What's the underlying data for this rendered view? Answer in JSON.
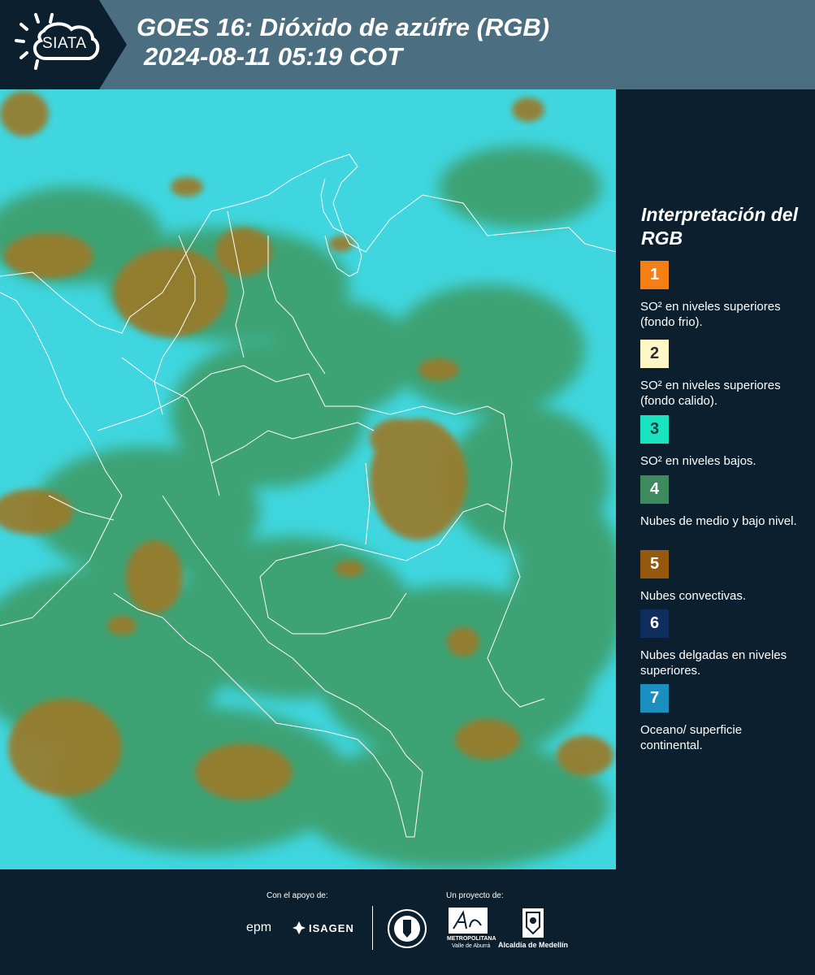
{
  "header": {
    "title_line1": "GOES 16: Dióxido de azúfre (RGB)",
    "title_line2": "2024-08-11 05:19 COT",
    "logo_text": "SIATA"
  },
  "legend": {
    "title": "Interpretación del RGB",
    "items": [
      {
        "number": "1",
        "label": "SO² en niveles superiores (fondo frio).",
        "color": "#f57f17",
        "text_color": "#ffffff"
      },
      {
        "number": "2",
        "label": "SO² en niveles superiores (fondo calido).",
        "color": "#fff8c6",
        "text_color": "#2a2a2a"
      },
      {
        "number": "3",
        "label": "SO² en niveles bajos.",
        "color": "#19e3c0",
        "text_color": "#1f3a3a"
      },
      {
        "number": "4",
        "label": "Nubes de medio y bajo nivel.",
        "color": "#3c8a5d",
        "text_color": "#ffffff"
      },
      {
        "number": "5",
        "label": "Nubes convectivas.",
        "color": "#94590f",
        "text_color": "#ffffff"
      },
      {
        "number": "6",
        "label": "Nubes delgadas en niveles superiores.",
        "color": "#0f2e5e",
        "text_color": "#ffffff"
      },
      {
        "number": "7",
        "label": "Oceano/ superficie continental.",
        "color": "#1b8fc0",
        "text_color": "#ffffff"
      }
    ]
  },
  "footer": {
    "support_caption": "Con el apoyo de:",
    "project_caption": "Un proyecto de:",
    "sponsor_1": "epm",
    "sponsor_2": "ISAGEN",
    "partner_1": "METROPOLITANA",
    "partner_1_sub": "Valle de Aburrá",
    "partner_2": "Alcaldía de Medellín"
  },
  "map": {
    "ocean_color": "#3fd6df",
    "low_cloud_color": "#3d9a62",
    "convective_color": "#9a7a2a",
    "border_color": "#ffffff"
  }
}
